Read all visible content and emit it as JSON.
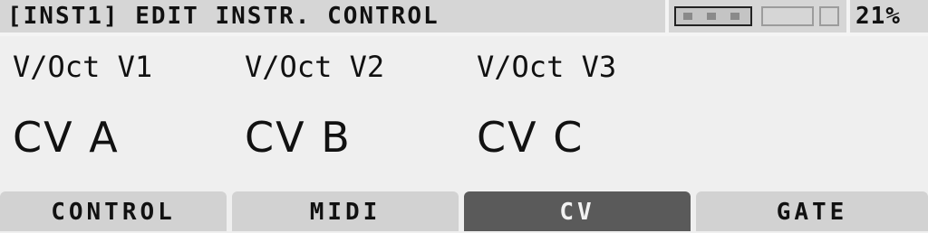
{
  "header": {
    "title": "[INST1] EDIT INSTR. CONTROL",
    "battery_percent": "21%"
  },
  "columns": [
    {
      "label": "V/Oct V1",
      "value": "CV A"
    },
    {
      "label": "V/Oct V2",
      "value": "CV B"
    },
    {
      "label": "V/Oct V3",
      "value": "CV C"
    }
  ],
  "tabs": [
    {
      "label": "CONTROL",
      "active": false
    },
    {
      "label": "MIDI",
      "active": false
    },
    {
      "label": "CV",
      "active": true
    },
    {
      "label": "GATE",
      "active": false
    }
  ],
  "colors": {
    "background": "#efefef",
    "header_bg": "#d6d6d6",
    "tab_bg": "#d2d2d2",
    "tab_active_bg": "#5a5a5a",
    "text": "#111111"
  }
}
